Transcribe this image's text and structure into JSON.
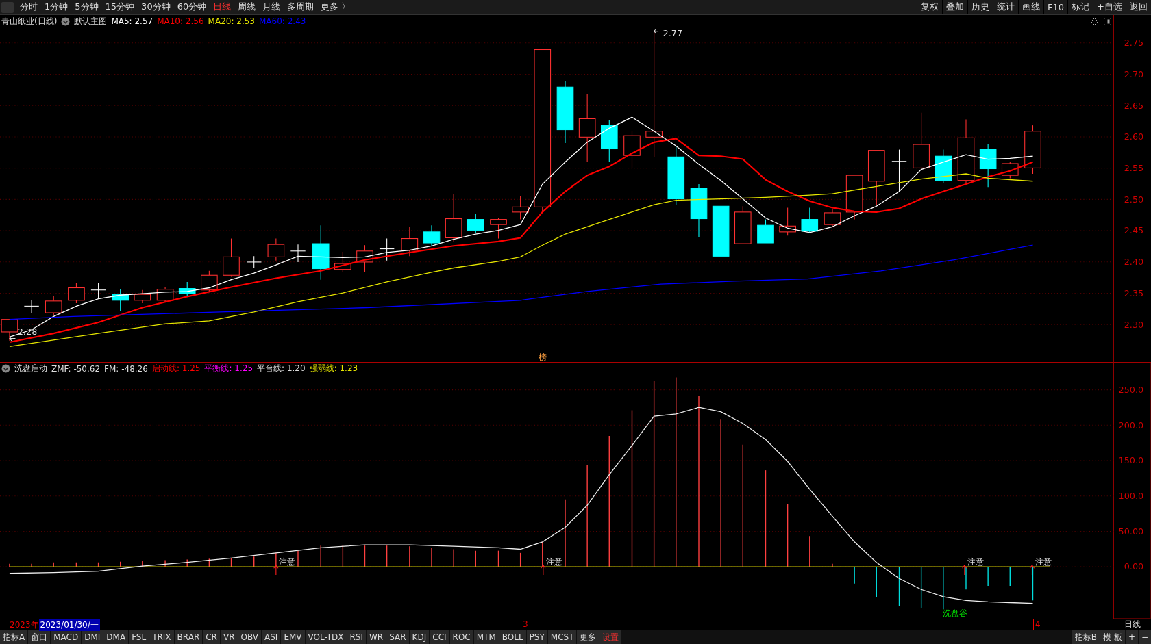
{
  "toolbar": {
    "periods": [
      {
        "label": "分时",
        "selected": false
      },
      {
        "label": "1分钟",
        "selected": false
      },
      {
        "label": "5分钟",
        "selected": false
      },
      {
        "label": "15分钟",
        "selected": false
      },
      {
        "label": "30分钟",
        "selected": false
      },
      {
        "label": "60分钟",
        "selected": false
      },
      {
        "label": "日线",
        "selected": true
      },
      {
        "label": "周线",
        "selected": false
      },
      {
        "label": "月线",
        "selected": false
      },
      {
        "label": "多周期",
        "selected": false
      },
      {
        "label": "更多 〉",
        "selected": false
      }
    ],
    "actions": [
      "复权",
      "叠加",
      "历史",
      "统计",
      "画线",
      "F10",
      "标记",
      "+自选",
      "返回"
    ]
  },
  "main_chart": {
    "title": "青山纸业(日线)",
    "template": "默认主图",
    "indicators": [
      {
        "label": "MA5: 2.57",
        "color": "#ffffff"
      },
      {
        "label": "MA10: 2.56",
        "color": "#ff0000"
      },
      {
        "label": "MA20: 2.53",
        "color": "#e6e600"
      },
      {
        "label": "MA60: 2.43",
        "color": "#0000ff"
      }
    ],
    "high_label": "2.77",
    "low_label": "2.28",
    "marker": "榜",
    "price_axis": [
      "2.75",
      "2.70",
      "2.65",
      "2.60",
      "2.55",
      "2.50",
      "2.45",
      "2.40",
      "2.35",
      "2.30"
    ]
  },
  "indicator_chart": {
    "title": "洗盘启动",
    "indicators": [
      {
        "label": "ZMF: -50.62",
        "color": "#dddddd"
      },
      {
        "label": "FM: -48.26",
        "color": "#dddddd"
      },
      {
        "label": "启动线: 1.25",
        "color": "#ff0000"
      },
      {
        "label": "平衡线: 1.25",
        "color": "#ff00ff"
      },
      {
        "label": "平台线: 1.20",
        "color": "#dddddd"
      },
      {
        "label": "强弱线: 1.23",
        "color": "#e6e600"
      }
    ],
    "alerts": [
      "注意",
      "注意",
      "注意",
      "注意"
    ],
    "valley_label": "洗盘谷",
    "value_axis": [
      "250.0",
      "200.0",
      "150.0",
      "100.0",
      "50.00",
      "0.00"
    ]
  },
  "date_axis": {
    "year": "2023年",
    "cursor_date": "2023/01/30/一",
    "month_marks": [
      "3",
      "4"
    ],
    "period": "日线"
  },
  "bottom_bar": {
    "tabs": [
      {
        "label": "指标A",
        "kind": "tab"
      },
      {
        "label": "窗口",
        "kind": "tab"
      },
      {
        "label": "MACD",
        "kind": "tab"
      },
      {
        "label": "DMI",
        "kind": "tab"
      },
      {
        "label": "DMA",
        "kind": "tab"
      },
      {
        "label": "FSL",
        "kind": "tab"
      },
      {
        "label": "TRIX",
        "kind": "tab"
      },
      {
        "label": "BRAR",
        "kind": "tab"
      },
      {
        "label": "CR",
        "kind": "tab"
      },
      {
        "label": "VR",
        "kind": "tab"
      },
      {
        "label": "OBV",
        "kind": "tab"
      },
      {
        "label": "ASI",
        "kind": "tab"
      },
      {
        "label": "EMV",
        "kind": "tab"
      },
      {
        "label": "VOL-TDX",
        "kind": "tab"
      },
      {
        "label": "RSI",
        "kind": "tab"
      },
      {
        "label": "WR",
        "kind": "tab"
      },
      {
        "label": "SAR",
        "kind": "tab"
      },
      {
        "label": "KDJ",
        "kind": "tab"
      },
      {
        "label": "CCI",
        "kind": "tab"
      },
      {
        "label": "ROC",
        "kind": "tab"
      },
      {
        "label": "MTM",
        "kind": "tab"
      },
      {
        "label": "BOLL",
        "kind": "tab"
      },
      {
        "label": "PSY",
        "kind": "tab"
      },
      {
        "label": "MCST",
        "kind": "tab"
      },
      {
        "label": "更多",
        "kind": "tab"
      },
      {
        "label": "设置",
        "kind": "settings"
      }
    ],
    "right_buttons": [
      "指标B",
      "模 板",
      "+",
      "−"
    ]
  }
}
